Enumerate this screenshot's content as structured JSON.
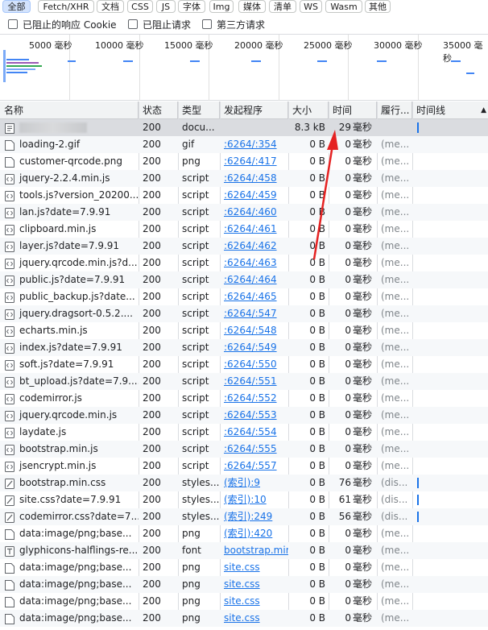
{
  "filters": [
    "全部",
    "Fetch/XHR",
    "文档",
    "CSS",
    "JS",
    "字体",
    "Img",
    "媒体",
    "清单",
    "WS",
    "Wasm",
    "其他"
  ],
  "checkboxes": [
    "已阻止的响应 Cookie",
    "已阻止请求",
    "第三方请求"
  ],
  "overview_ticks": [
    "5000 毫秒",
    "10000 毫秒",
    "15000 毫秒",
    "20000 毫秒",
    "25000 毫秒",
    "30000 毫秒",
    "35000 毫秒"
  ],
  "columns": {
    "name": "名称",
    "status": "状态",
    "type": "类型",
    "initiator": "发起程序",
    "size": "大小",
    "time": "时间",
    "waterfall": "履行...",
    "timeline": "时间线"
  },
  "colors": {
    "link": "#1a73e8",
    "accent_bar": "#1a73e8",
    "selection": "#dadce0",
    "annotation_arrow": "#e52222"
  },
  "rows": [
    {
      "name": "",
      "status": "200",
      "type": "docu...",
      "initiator": "",
      "link": false,
      "size": "8.3 kB",
      "time": "29",
      "unit": "毫秒",
      "wf": "",
      "icon": "document-icon",
      "tl": true,
      "sel": true
    },
    {
      "name": "loading-2.gif",
      "status": "200",
      "type": "gif",
      "initiator": ":6264/:354",
      "link": true,
      "size": "0 B",
      "time": "0",
      "unit": "毫秒",
      "wf": "(me...",
      "icon": "file-icon"
    },
    {
      "name": "customer-qrcode.png",
      "status": "200",
      "type": "png",
      "initiator": ":6264/:417",
      "link": true,
      "size": "0 B",
      "time": "0",
      "unit": "毫秒",
      "wf": "(me...",
      "icon": "file-icon"
    },
    {
      "name": "jquery-2.2.4.min.js",
      "status": "200",
      "type": "script",
      "initiator": ":6264/:458",
      "link": true,
      "size": "0 B",
      "time": "0",
      "unit": "毫秒",
      "wf": "(me...",
      "icon": "script-icon"
    },
    {
      "name": "tools.js?version_20200...",
      "status": "200",
      "type": "script",
      "initiator": ":6264/:459",
      "link": true,
      "size": "0 B",
      "time": "0",
      "unit": "毫秒",
      "wf": "(me...",
      "icon": "script-icon"
    },
    {
      "name": "lan.js?date=7.9.91",
      "status": "200",
      "type": "script",
      "initiator": ":6264/:460",
      "link": true,
      "size": "0 B",
      "time": "0",
      "unit": "毫秒",
      "wf": "(me...",
      "icon": "script-icon"
    },
    {
      "name": "clipboard.min.js",
      "status": "200",
      "type": "script",
      "initiator": ":6264/:461",
      "link": true,
      "size": "0 B",
      "time": "0",
      "unit": "毫秒",
      "wf": "(me...",
      "icon": "script-icon"
    },
    {
      "name": "layer.js?date=7.9.91",
      "status": "200",
      "type": "script",
      "initiator": ":6264/:462",
      "link": true,
      "size": "0 B",
      "time": "0",
      "unit": "毫秒",
      "wf": "(me...",
      "icon": "script-icon"
    },
    {
      "name": "jquery.qrcode.min.js?d...",
      "status": "200",
      "type": "script",
      "initiator": ":6264/:463",
      "link": true,
      "size": "0 B",
      "time": "0",
      "unit": "毫秒",
      "wf": "(me...",
      "icon": "script-icon"
    },
    {
      "name": "public.js?date=7.9.91",
      "status": "200",
      "type": "script",
      "initiator": ":6264/:464",
      "link": true,
      "size": "0 B",
      "time": "0",
      "unit": "毫秒",
      "wf": "(me...",
      "icon": "script-icon"
    },
    {
      "name": "public_backup.js?date...",
      "status": "200",
      "type": "script",
      "initiator": ":6264/:465",
      "link": true,
      "size": "0 B",
      "time": "0",
      "unit": "毫秒",
      "wf": "(me...",
      "icon": "script-icon"
    },
    {
      "name": "jquery.dragsort-0.5.2....",
      "status": "200",
      "type": "script",
      "initiator": ":6264/:547",
      "link": true,
      "size": "0 B",
      "time": "0",
      "unit": "毫秒",
      "wf": "(me...",
      "icon": "script-icon"
    },
    {
      "name": "echarts.min.js",
      "status": "200",
      "type": "script",
      "initiator": ":6264/:548",
      "link": true,
      "size": "0 B",
      "time": "0",
      "unit": "毫秒",
      "wf": "(me...",
      "icon": "script-icon"
    },
    {
      "name": "index.js?date=7.9.91",
      "status": "200",
      "type": "script",
      "initiator": ":6264/:549",
      "link": true,
      "size": "0 B",
      "time": "0",
      "unit": "毫秒",
      "wf": "(me...",
      "icon": "script-icon"
    },
    {
      "name": "soft.js?date=7.9.91",
      "status": "200",
      "type": "script",
      "initiator": ":6264/:550",
      "link": true,
      "size": "0 B",
      "time": "0",
      "unit": "毫秒",
      "wf": "(me...",
      "icon": "script-icon"
    },
    {
      "name": "bt_upload.js?date=7.9....",
      "status": "200",
      "type": "script",
      "initiator": ":6264/:551",
      "link": true,
      "size": "0 B",
      "time": "0",
      "unit": "毫秒",
      "wf": "(me...",
      "icon": "script-icon"
    },
    {
      "name": "codemirror.js",
      "status": "200",
      "type": "script",
      "initiator": ":6264/:552",
      "link": true,
      "size": "0 B",
      "time": "0",
      "unit": "毫秒",
      "wf": "(me...",
      "icon": "script-icon"
    },
    {
      "name": "jquery.qrcode.min.js",
      "status": "200",
      "type": "script",
      "initiator": ":6264/:553",
      "link": true,
      "size": "0 B",
      "time": "0",
      "unit": "毫秒",
      "wf": "(me...",
      "icon": "script-icon"
    },
    {
      "name": "laydate.js",
      "status": "200",
      "type": "script",
      "initiator": ":6264/:554",
      "link": true,
      "size": "0 B",
      "time": "0",
      "unit": "毫秒",
      "wf": "(me...",
      "icon": "script-icon"
    },
    {
      "name": "bootstrap.min.js",
      "status": "200",
      "type": "script",
      "initiator": ":6264/:555",
      "link": true,
      "size": "0 B",
      "time": "0",
      "unit": "毫秒",
      "wf": "(me...",
      "icon": "script-icon"
    },
    {
      "name": "jsencrypt.min.js",
      "status": "200",
      "type": "script",
      "initiator": ":6264/:557",
      "link": true,
      "size": "0 B",
      "time": "0",
      "unit": "毫秒",
      "wf": "(me...",
      "icon": "script-icon"
    },
    {
      "name": "bootstrap.min.css",
      "status": "200",
      "type": "styles...",
      "initiator": "(索引):9",
      "link": true,
      "size": "0 B",
      "time": "76",
      "unit": "毫秒",
      "wf": "(dis...",
      "icon": "stylesheet-icon",
      "tl": true
    },
    {
      "name": "site.css?date=7.9.91",
      "status": "200",
      "type": "styles...",
      "initiator": "(索引):10",
      "link": true,
      "size": "0 B",
      "time": "61",
      "unit": "毫秒",
      "wf": "(dis...",
      "icon": "stylesheet-icon",
      "tl": true
    },
    {
      "name": "codemirror.css?date=7....",
      "status": "200",
      "type": "styles...",
      "initiator": "(索引):249",
      "link": true,
      "size": "0 B",
      "time": "56",
      "unit": "毫秒",
      "wf": "(dis...",
      "icon": "stylesheet-icon",
      "tl": true
    },
    {
      "name": "data:image/png;base...",
      "status": "200",
      "type": "png",
      "initiator": "(索引):420",
      "link": true,
      "size": "0 B",
      "time": "0",
      "unit": "毫秒",
      "wf": "(me...",
      "icon": "file-icon"
    },
    {
      "name": "glyphicons-halflings-re...",
      "status": "200",
      "type": "font",
      "initiator": "bootstrap.min",
      "link": true,
      "size": "0 B",
      "time": "0",
      "unit": "毫秒",
      "wf": "(me...",
      "icon": "font-icon"
    },
    {
      "name": "data:image/png;base...",
      "status": "200",
      "type": "png",
      "initiator": "site.css",
      "link": true,
      "size": "0 B",
      "time": "0",
      "unit": "毫秒",
      "wf": "(me...",
      "icon": "file-icon"
    },
    {
      "name": "data:image/png;base...",
      "status": "200",
      "type": "png",
      "initiator": "site.css",
      "link": true,
      "size": "0 B",
      "time": "0",
      "unit": "毫秒",
      "wf": "(me...",
      "icon": "file-icon"
    },
    {
      "name": "data:image/png;base...",
      "status": "200",
      "type": "png",
      "initiator": "site.css",
      "link": true,
      "size": "0 B",
      "time": "0",
      "unit": "毫秒",
      "wf": "(me...",
      "icon": "file-icon"
    },
    {
      "name": "data:image/png;base...",
      "status": "200",
      "type": "png",
      "initiator": "site.css",
      "link": true,
      "size": "0 B",
      "time": "0",
      "unit": "毫秒",
      "wf": "(me...",
      "icon": "file-icon"
    }
  ]
}
